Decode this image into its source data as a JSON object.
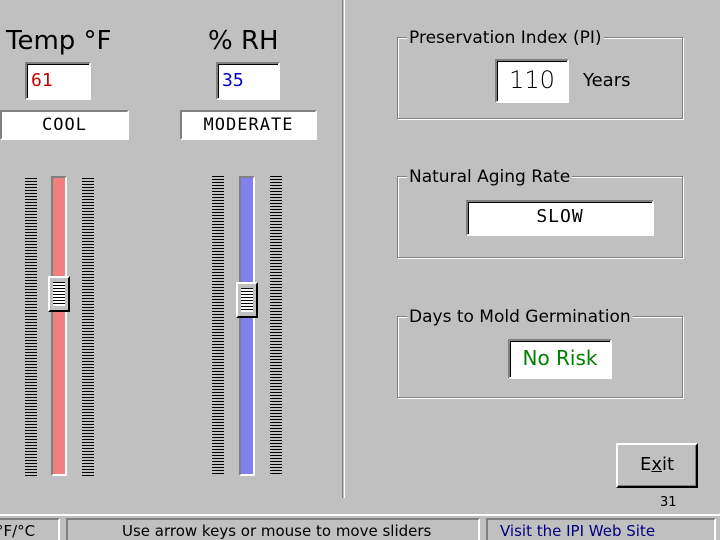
{
  "temperature": {
    "heading": "Temp °F",
    "value": "61",
    "value_color": "#cc0000",
    "state": "COOL",
    "slider_level_fraction": 0.62,
    "track_color": "#f08080"
  },
  "humidity": {
    "heading": "% RH",
    "value": "35",
    "value_color": "#0000cc",
    "state": "MODERATE",
    "slider_level_fraction": 0.6,
    "track_color": "#8080f0"
  },
  "preservation_index": {
    "label": "Preservation Index (PI)",
    "value": "110",
    "unit": "Years"
  },
  "natural_aging_rate": {
    "label": "Natural Aging Rate",
    "value": "SLOW"
  },
  "mold_germination": {
    "label": "Days to Mold Germination",
    "value": "No Risk",
    "value_color": "#008000"
  },
  "exit_button": {
    "label_pre": "E",
    "label_accel": "x",
    "label_post": "it"
  },
  "page_number": "31",
  "status_bar": {
    "units_toggle": "°F/°C",
    "hint": "Use arrow keys or mouse to move sliders",
    "link": "Visit the IPI Web Site",
    "link_color": "#000080"
  },
  "icons": {
    "slider_thumb": "slider-thumb-grip"
  }
}
